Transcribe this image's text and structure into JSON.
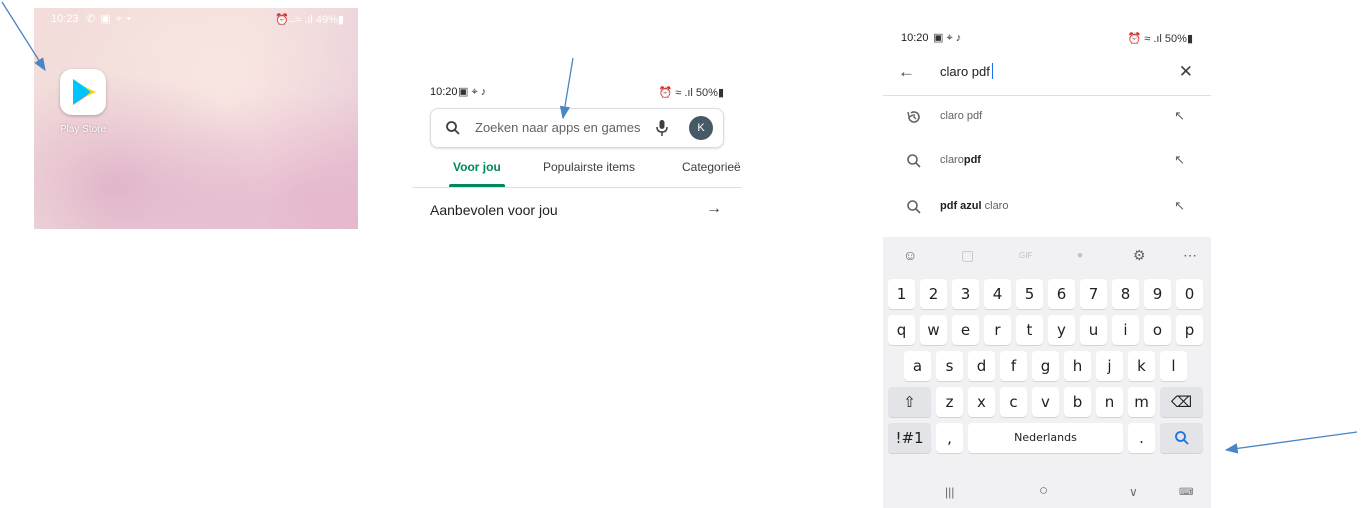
{
  "panel1": {
    "status_time": "10:23",
    "status_icons": "✆ ▣ ⌖ •",
    "status_right": "⏰ ̶ ≈ .ıl 49%▮",
    "app_label": "Play Store"
  },
  "panel2": {
    "status_time": "10:20",
    "status_icons": "▣ ⌖ ♪",
    "status_right": "⏰ ≈ .ıl 50%▮",
    "search_placeholder": "Zoeken naar apps en games",
    "avatar_initial": "K",
    "tabs": [
      "Voor jou",
      "Populairste items",
      "Categorieë"
    ],
    "section_title": "Aanbevolen voor jou",
    "section_arrow": "→"
  },
  "panel3": {
    "status_time": "10:20",
    "status_icons": "▣ ⌖ ♪",
    "status_right": "⏰ ≈ .ıl 50%▮",
    "back": "←",
    "query": "claro pdf",
    "clear": "✕",
    "suggestions": [
      {
        "icon": "history-icon",
        "plain": "claro pdf",
        "bold": ""
      },
      {
        "icon": "search-icon",
        "plain": "claro",
        "bold": "pdf"
      },
      {
        "icon": "search-icon",
        "plain": "claro",
        "bold": "pdf azul"
      }
    ],
    "suggestion_fill": "↖",
    "keyboard": {
      "toolbar": [
        "☺",
        "▢",
        "GIF",
        "●",
        "⚙",
        "⋯"
      ],
      "row_numbers": [
        "1",
        "2",
        "3",
        "4",
        "5",
        "6",
        "7",
        "8",
        "9",
        "0"
      ],
      "row1": [
        "q",
        "w",
        "e",
        "r",
        "t",
        "y",
        "u",
        "i",
        "o",
        "p"
      ],
      "row2": [
        "a",
        "s",
        "d",
        "f",
        "g",
        "h",
        "j",
        "k",
        "l"
      ],
      "row3": [
        "z",
        "x",
        "c",
        "v",
        "b",
        "n",
        "m"
      ],
      "shift": "⇧",
      "backspace": "⌫",
      "symbols": "!#1",
      "comma": ",",
      "space": "Nederlands",
      "period": ".",
      "search": "⌕"
    },
    "navbar": [
      "|||",
      "○",
      "∨",
      "⌨"
    ]
  },
  "colors": {
    "accent_green": "#01875f",
    "arrow_blue": "#4a86c6"
  }
}
